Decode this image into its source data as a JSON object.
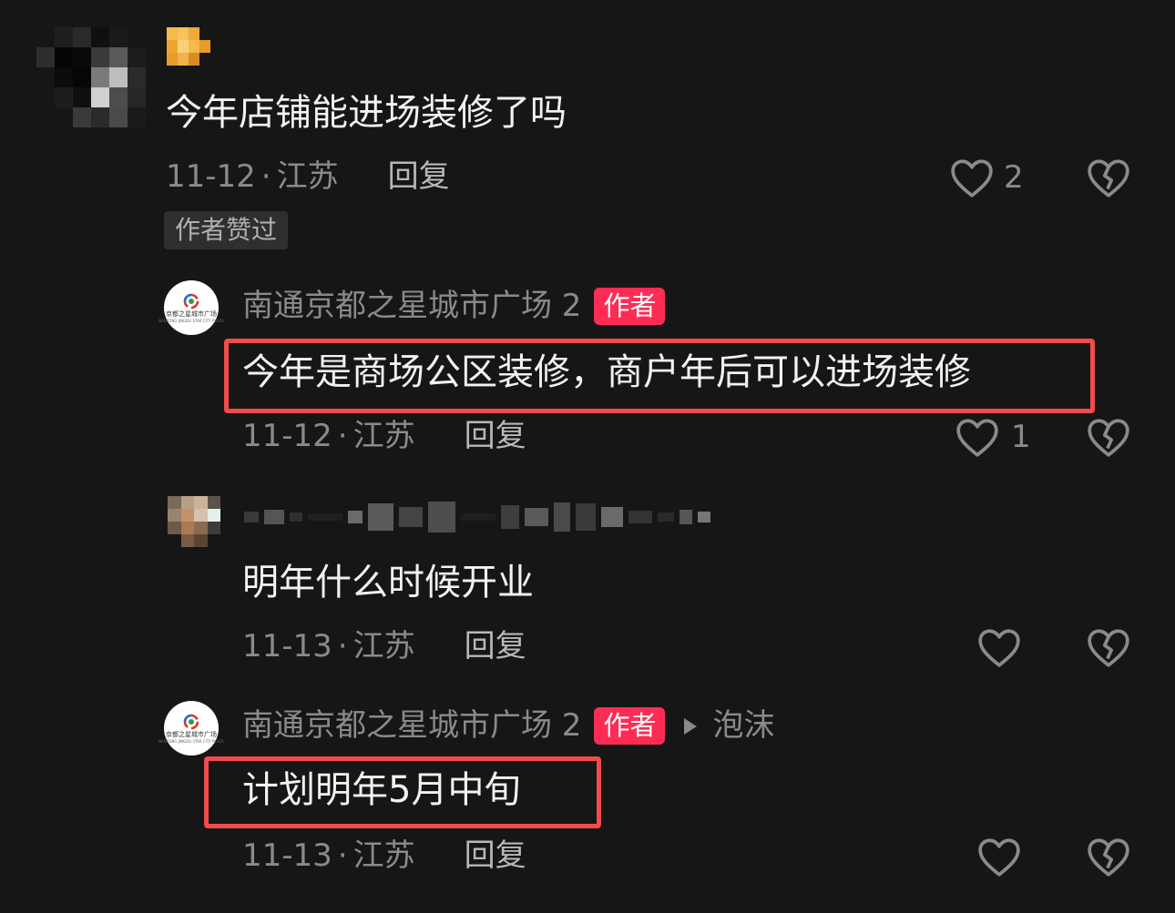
{
  "comment": {
    "text": "今年店铺能进场装修了吗",
    "date": "11-12",
    "location": "江苏",
    "reply_label": "回复",
    "like_count": "2",
    "liked_by_author_tag": "作者赞过"
  },
  "replies": [
    {
      "author": "南通京都之星城市广场 2",
      "author_tag": "作者",
      "text": "今年是商场公区装修，商户年后可以进场装修",
      "date": "11-12",
      "location": "江苏",
      "reply_label": "回复",
      "like_count": "1"
    },
    {
      "author": "",
      "text": "明年什么时候开业",
      "date": "11-13",
      "location": "江苏",
      "reply_label": "回复",
      "like_count": ""
    },
    {
      "author": "南通京都之星城市广场 2",
      "author_tag": "作者",
      "reply_to": "泡沫",
      "text": "计划明年5月中旬",
      "date": "11-13",
      "location": "江苏",
      "reply_label": "回复",
      "like_count": ""
    }
  ],
  "logo": {
    "name": "京都之星城市广场",
    "subtitle": "NANTONG JINGDU STAR CITY PLAZA"
  },
  "icons": {
    "like": "heart-outline-icon",
    "dislike": "broken-heart-icon",
    "reply_arrow": "triangle-right-icon"
  },
  "colors": {
    "background": "#161616",
    "author_tag": "#fe2c55",
    "highlight_box": "#f24b4b"
  }
}
